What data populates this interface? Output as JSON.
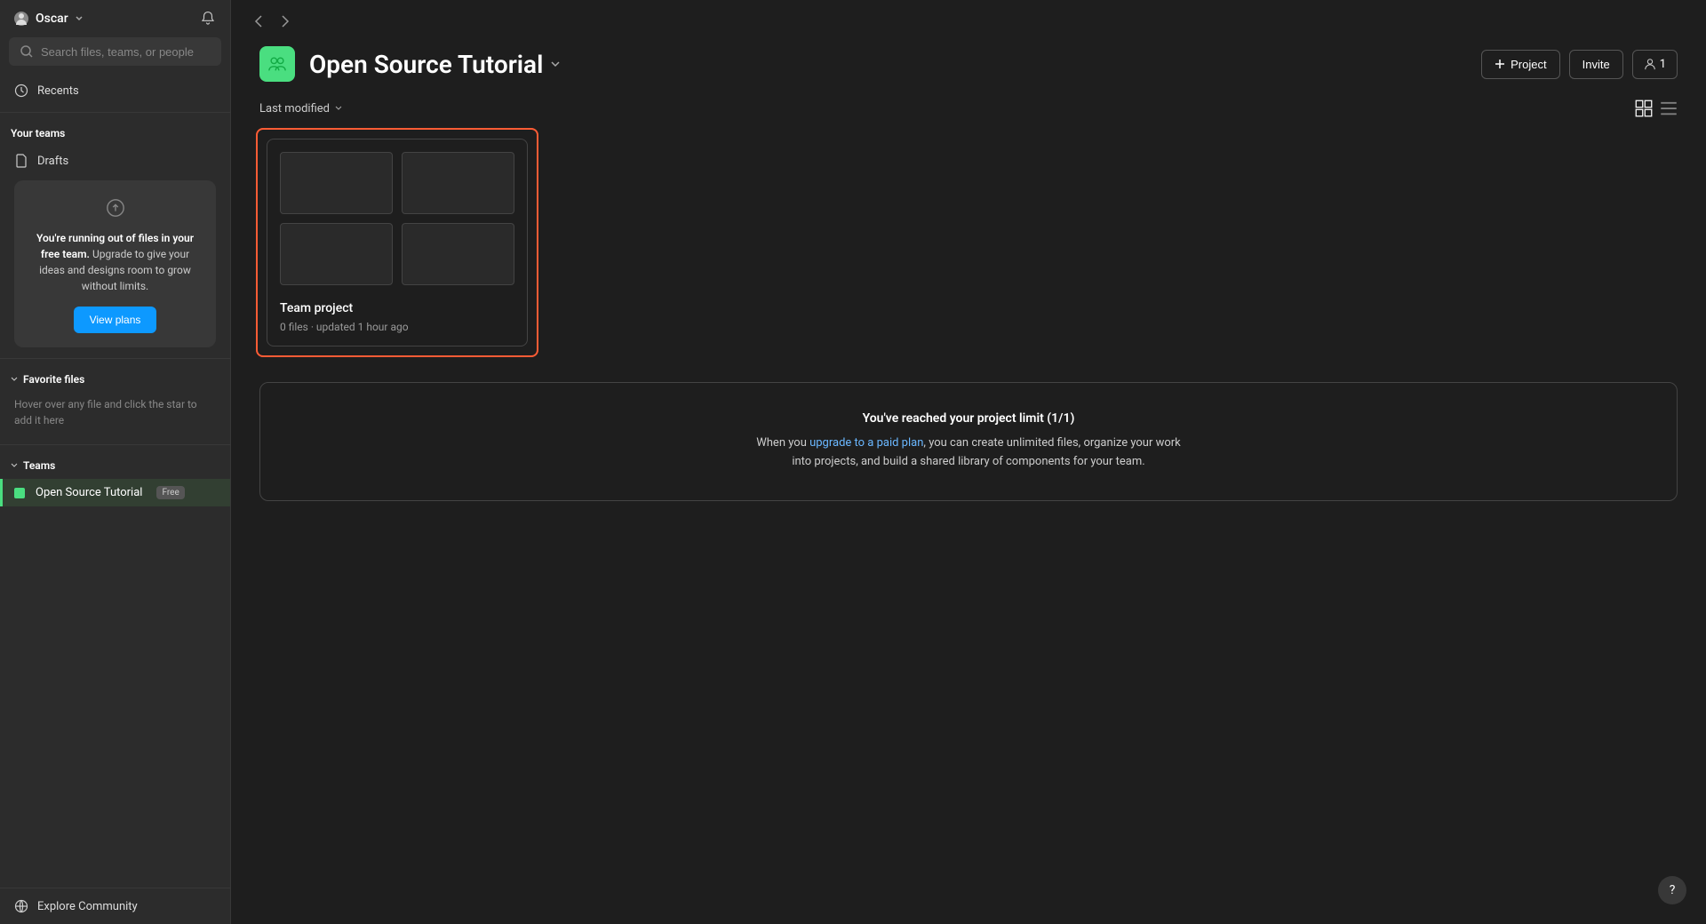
{
  "account": {
    "name": "Oscar",
    "initial": "O"
  },
  "search": {
    "placeholder": "Search files, teams, or people"
  },
  "nav": {
    "recents": "Recents",
    "your_teams": "Your teams",
    "drafts": "Drafts"
  },
  "upgrade_card": {
    "bold_text": "You're running out of files in your free team.",
    "body_text": " Upgrade to give your ideas and designs room to grow without limits.",
    "button": "View plans"
  },
  "favorites": {
    "header": "Favorite files",
    "helper": "Hover over any file and click the star to add it here"
  },
  "teams_section": {
    "header": "Teams",
    "items": [
      {
        "name": "Open Source Tutorial",
        "badge": "Free"
      }
    ]
  },
  "sidebar_bottom": {
    "explore": "Explore Community"
  },
  "main": {
    "team_title": "Open Source Tutorial",
    "project_button": "Project",
    "invite_button": "Invite",
    "member_count": "1",
    "sort_label": "Last modified"
  },
  "project_card": {
    "name": "Team project",
    "subtitle": "0 files · updated 1 hour ago"
  },
  "limit_notice": {
    "title": "You've reached your project limit (1/1)",
    "prefix": "When you ",
    "link": "upgrade to a paid plan",
    "suffix": ", you can create unlimited files, organize your work into projects, and build a shared library of components for your team."
  },
  "help": "?"
}
